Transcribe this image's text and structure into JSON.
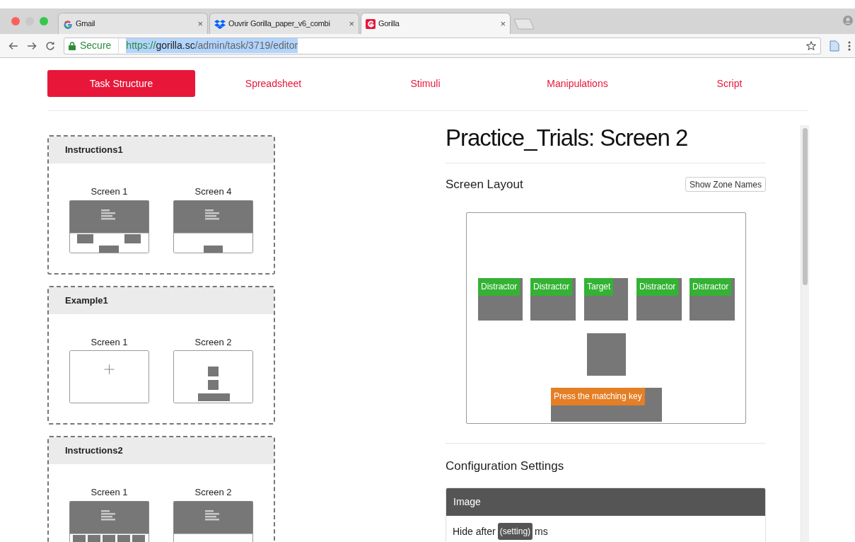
{
  "browser": {
    "tabs": [
      {
        "title": "Gmail",
        "kind": "google",
        "selected": false,
        "close": "×"
      },
      {
        "title": "Ouvrir Gorilla_paper_v6_combi",
        "kind": "dropbox",
        "selected": false,
        "close": "×"
      },
      {
        "title": "Gorilla",
        "kind": "gorilla",
        "selected": true,
        "close": "×"
      }
    ],
    "url": {
      "security": "Secure",
      "scheme": "https://",
      "host": "gorilla.sc",
      "path": "/admin/task/3719/editor"
    }
  },
  "nav": [
    {
      "label": "Task Structure",
      "selected": true
    },
    {
      "label": "Spreadsheet",
      "selected": false
    },
    {
      "label": "Stimuli",
      "selected": false
    },
    {
      "label": "Manipulations",
      "selected": false
    },
    {
      "label": "Script",
      "selected": false
    }
  ],
  "task_cards": [
    {
      "title": "Instructions1",
      "screens": [
        {
          "label": "Screen 1",
          "kind": "text-two-buttons"
        },
        {
          "label": "Screen 4",
          "kind": "text-button"
        }
      ]
    },
    {
      "title": "Example1",
      "screens": [
        {
          "label": "Screen 1",
          "kind": "fixation"
        },
        {
          "label": "Screen 2",
          "kind": "stack"
        }
      ]
    },
    {
      "title": "Instructions2",
      "screens": [
        {
          "label": "Screen 1",
          "kind": "text-five-buttons"
        },
        {
          "label": "Screen 2",
          "kind": "text-button"
        }
      ]
    }
  ],
  "editor": {
    "title": "Practice_Trials: Screen 2",
    "screen_layout": {
      "heading": "Screen Layout",
      "button": "Show Zone Names",
      "zones": [
        {
          "kind": "labeled",
          "label": "Distractor",
          "color": "#34b234"
        },
        {
          "kind": "labeled",
          "label": "Distractor",
          "color": "#34b234"
        },
        {
          "kind": "labeled",
          "label": "Target",
          "color": "#34b234"
        },
        {
          "kind": "labeled",
          "label": "Distractor",
          "color": "#34b234"
        },
        {
          "kind": "labeled",
          "label": "Distractor",
          "color": "#34b234"
        },
        {
          "kind": "blank"
        },
        {
          "kind": "labeled",
          "label": "Press the matching key",
          "color": "#e47f26"
        }
      ]
    },
    "configuration": {
      "heading": "Configuration Settings",
      "panel": {
        "title": "Image",
        "row": {
          "before": "Hide after",
          "badge": "(setting)",
          "after": "ms"
        }
      }
    }
  }
}
